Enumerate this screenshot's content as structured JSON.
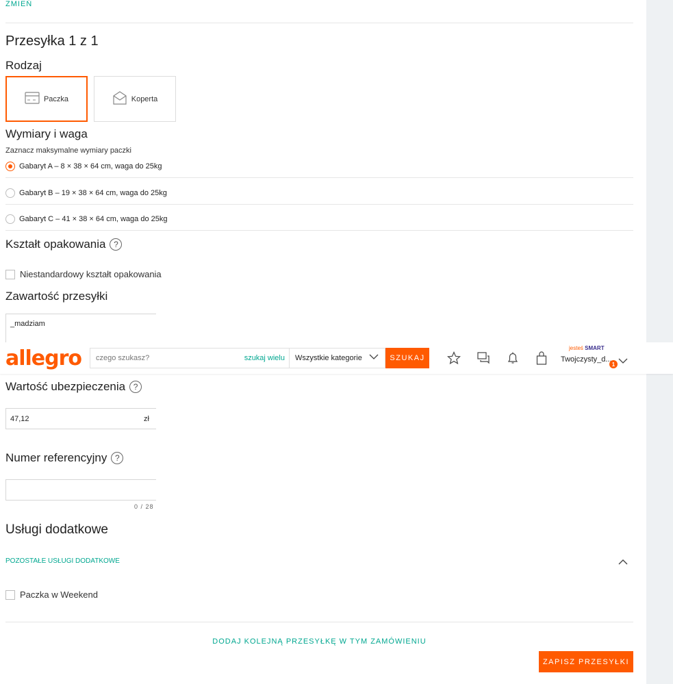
{
  "top_link": "ZMIEŃ",
  "shipment": {
    "title": "Przesyłka 1 z 1",
    "type_heading": "Rodzaj",
    "types": [
      {
        "label": "Paczka",
        "selected": true,
        "icon": "package-icon"
      },
      {
        "label": "Koperta",
        "selected": false,
        "icon": "envelope-icon"
      }
    ],
    "dims_heading": "Wymiary i waga",
    "dims_hint": "Zaznacz maksymalne wymiary paczki",
    "sizes": [
      {
        "label": "Gabaryt A – 8 × 38 × 64 cm, waga do 25kg",
        "selected": true
      },
      {
        "label": "Gabaryt B – 19 × 38 × 64 cm, waga do 25kg",
        "selected": false
      },
      {
        "label": "Gabaryt C – 41 × 38 × 64 cm, waga do 25kg",
        "selected": false
      }
    ],
    "shape_heading": "Kształt opakowania",
    "shape_checkbox": "Niestandardowy kształt opakowania",
    "content_heading": "Zawartość przesyłki",
    "content_value": "_madziam",
    "insurance_heading": "Wartość ubezpieczenia",
    "insurance_value": "47,12",
    "insurance_unit": "zł",
    "reference_heading": "Numer referencyjny",
    "reference_value": "",
    "reference_counter": "0 / 28",
    "extras_heading": "Usługi dodatkowe",
    "extras_toggle": "POZOSTAŁE USŁUGI DODATKOWE",
    "weekend_checkbox": "Paczka w Weekend",
    "add_shipment": "DODAJ KOLEJNĄ PRZESYŁKĘ W TYM ZAMÓWIENIU",
    "save": "ZAPISZ PRZESYŁKI"
  },
  "header": {
    "logo": "allegro",
    "search_placeholder": "czego szukasz?",
    "search_many": "szukaj wielu",
    "category": "Wszystkie kategorie",
    "search_button": "SZUKAJ",
    "smart_prefix": "jesteś",
    "smart_label": "SMART",
    "username": "Twojczysty_d...",
    "badge_count": "1"
  },
  "colors": {
    "accent": "#ff5a00",
    "link": "#00a790",
    "smart": "#3a2e8c"
  }
}
